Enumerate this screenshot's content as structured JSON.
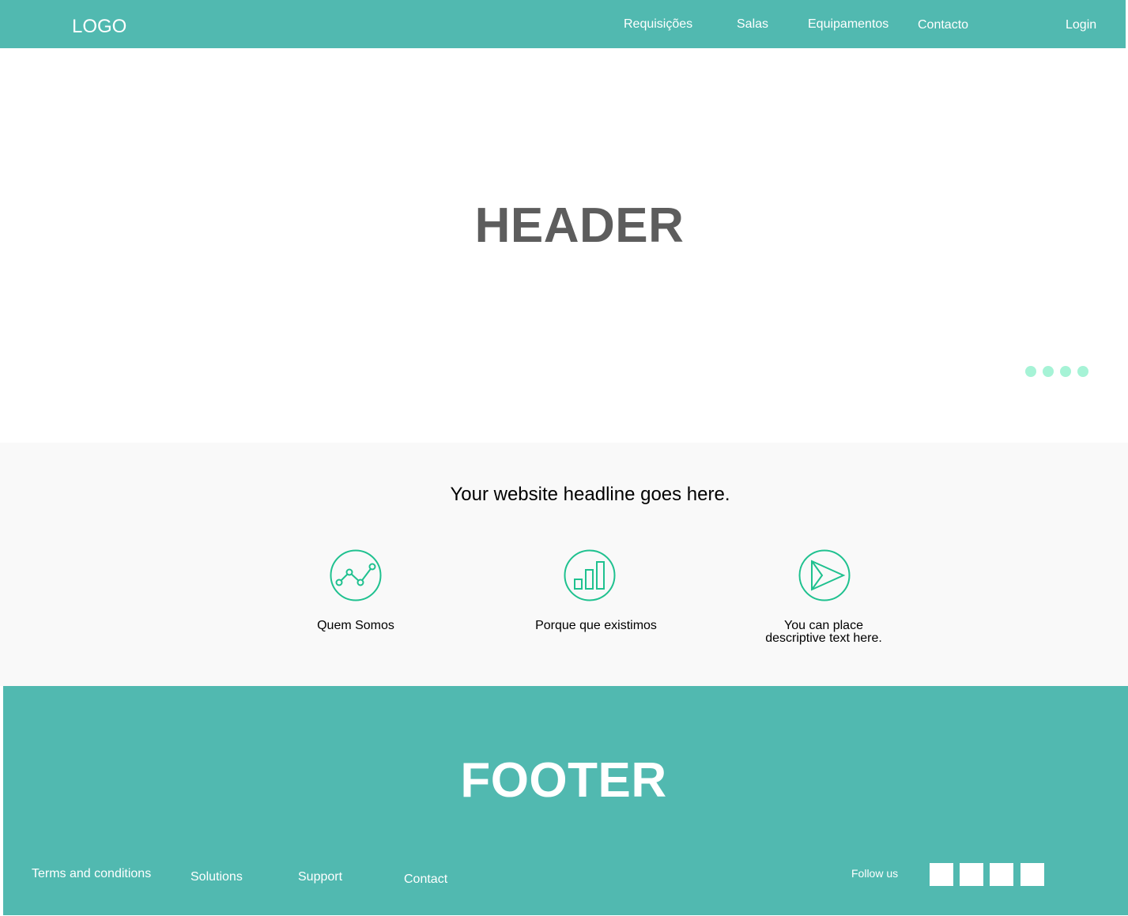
{
  "nav": {
    "logo": "LOGO",
    "links": [
      "Requisições",
      "Salas",
      "Equipamentos",
      "Contacto"
    ],
    "login": "Login"
  },
  "hero": {
    "title": "HEADER",
    "carousel_dot_count": 4
  },
  "features": {
    "headline": "Your website headline goes here.",
    "items": [
      {
        "icon": "line-chart-icon",
        "label": "Quem Somos"
      },
      {
        "icon": "bar-chart-icon",
        "label": "Porque que existimos"
      },
      {
        "icon": "play-icon",
        "label_line1": "You can place",
        "label_line2": "descriptive text here."
      }
    ]
  },
  "footer": {
    "title": "FOOTER",
    "links": [
      "Terms and conditions",
      "Solutions",
      "Support",
      "Contact"
    ],
    "follow_label": "Follow us",
    "social_icon_count": 4
  },
  "colors": {
    "brand": "#51b9b0",
    "accent": "#1fc18f",
    "dot": "#a6f3d6",
    "hero_text": "#5d5d5d",
    "section_bg": "#f9f9f9"
  }
}
